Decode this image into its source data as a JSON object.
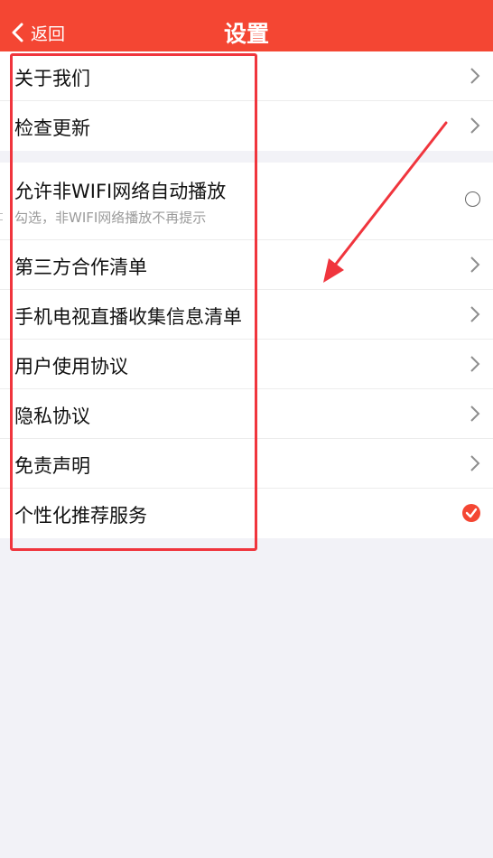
{
  "header": {
    "back_label": "返回",
    "title": "设置",
    "background": "#f44633"
  },
  "group1": {
    "items": [
      {
        "label": "关于我们",
        "icon": "chevron-right-icon"
      },
      {
        "label": "检查更新",
        "icon": "chevron-right-icon"
      }
    ]
  },
  "group2": {
    "autoplay": {
      "label": "允许非WIFI网络自动播放",
      "sub": "勾选，非WIFI网络播放不再提示",
      "checked": false
    },
    "items": [
      {
        "label": "第三方合作清单",
        "icon": "chevron-right-icon"
      },
      {
        "label": "手机电视直播收集信息清单",
        "icon": "chevron-right-icon"
      },
      {
        "label": "用户使用协议",
        "icon": "chevron-right-icon"
      },
      {
        "label": "隐私协议",
        "icon": "chevron-right-icon"
      },
      {
        "label": "免责声明",
        "icon": "chevron-right-icon"
      }
    ],
    "personalized": {
      "label": "个性化推荐服务",
      "checked": true
    }
  },
  "annotation_color": "#f0353d"
}
